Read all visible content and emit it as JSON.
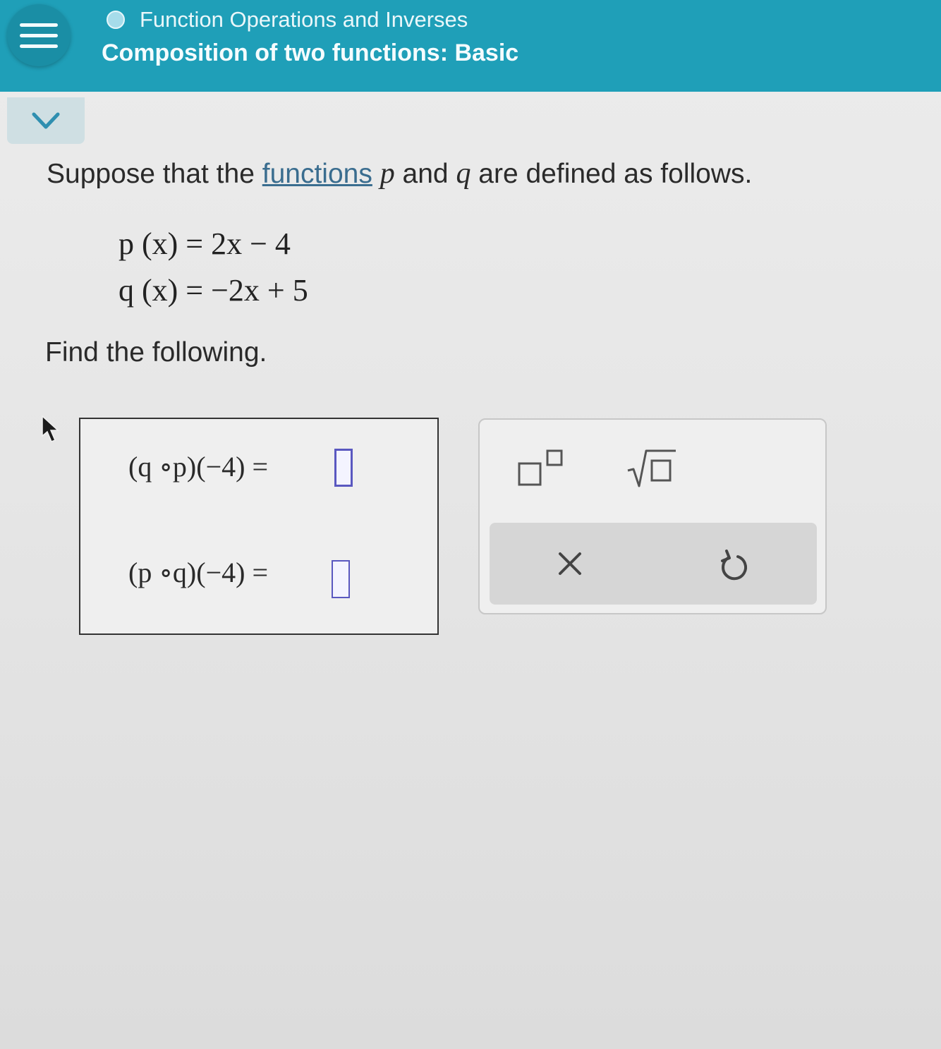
{
  "header": {
    "topic": "Function Operations and Inverses",
    "lesson": "Composition of two functions: Basic"
  },
  "question": {
    "prefix": "Suppose that the ",
    "link_text": "functions",
    "var_p": "p",
    "and_text": " and ",
    "var_q": "q",
    "suffix": " are defined as follows."
  },
  "definitions": [
    "p (x) = 2x − 4",
    "q (x) = −2x + 5"
  ],
  "find_text": "Find the following.",
  "expressions": [
    "(q ∘p)(−4) =",
    "(p ∘q)(−4) ="
  ],
  "colors": {
    "header_bg": "#1f9fb8",
    "link": "#3a6d8f",
    "answer_input_border": "#5a58c0"
  },
  "icons": {
    "menu": "hamburger-menu-icon",
    "topic_status": "circle-icon",
    "collapse": "chevron-down-icon",
    "superscript": "superscript-template-icon",
    "sqrt": "square-root-template-icon",
    "clear": "close-x-icon",
    "undo": "undo-arrow-icon",
    "pointer": "mouse-pointer-icon"
  }
}
